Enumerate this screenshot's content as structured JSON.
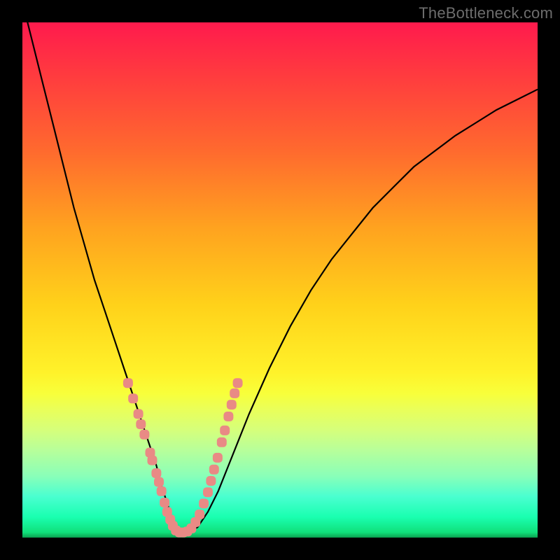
{
  "watermark": {
    "text": "TheBottleneck.com"
  },
  "chart_data": {
    "type": "line",
    "title": "",
    "xlabel": "",
    "ylabel": "",
    "xlim": [
      0,
      100
    ],
    "ylim": [
      0,
      100
    ],
    "series": [
      {
        "name": "bottleneck-curve",
        "x": [
          0,
          2,
          4,
          6,
          8,
          10,
          12,
          14,
          16,
          18,
          20,
          22,
          24,
          26,
          27,
          28,
          29,
          30,
          31,
          32,
          34,
          36,
          38,
          40,
          44,
          48,
          52,
          56,
          60,
          64,
          68,
          72,
          76,
          80,
          84,
          88,
          92,
          96,
          100
        ],
        "y": [
          104,
          96,
          88,
          80,
          72,
          64,
          57,
          50,
          44,
          38,
          32,
          26,
          20,
          14,
          10,
          7,
          4,
          2,
          1,
          1,
          2,
          5,
          9,
          14,
          24,
          33,
          41,
          48,
          54,
          59,
          64,
          68,
          72,
          75,
          78,
          80.5,
          83,
          85,
          87
        ]
      }
    ],
    "markers": [
      {
        "x": 20.5,
        "y": 30
      },
      {
        "x": 21.5,
        "y": 27
      },
      {
        "x": 22.5,
        "y": 24
      },
      {
        "x": 23.0,
        "y": 22
      },
      {
        "x": 23.7,
        "y": 20
      },
      {
        "x": 24.8,
        "y": 16.5
      },
      {
        "x": 25.2,
        "y": 15
      },
      {
        "x": 26.0,
        "y": 12.5
      },
      {
        "x": 26.5,
        "y": 10.8
      },
      {
        "x": 27.0,
        "y": 9.0
      },
      {
        "x": 27.6,
        "y": 6.8
      },
      {
        "x": 28.1,
        "y": 5.0
      },
      {
        "x": 28.7,
        "y": 3.5
      },
      {
        "x": 29.2,
        "y": 2.3
      },
      {
        "x": 29.8,
        "y": 1.4
      },
      {
        "x": 30.5,
        "y": 1.0
      },
      {
        "x": 31.2,
        "y": 1.0
      },
      {
        "x": 32.0,
        "y": 1.2
      },
      {
        "x": 32.8,
        "y": 1.8
      },
      {
        "x": 33.6,
        "y": 3.0
      },
      {
        "x": 34.4,
        "y": 4.5
      },
      {
        "x": 35.2,
        "y": 6.6
      },
      {
        "x": 36.0,
        "y": 8.8
      },
      {
        "x": 36.6,
        "y": 11.0
      },
      {
        "x": 37.2,
        "y": 13.2
      },
      {
        "x": 37.9,
        "y": 15.5
      },
      {
        "x": 38.7,
        "y": 18.5
      },
      {
        "x": 39.3,
        "y": 20.8
      },
      {
        "x": 40.0,
        "y": 23.5
      },
      {
        "x": 40.6,
        "y": 25.8
      },
      {
        "x": 41.2,
        "y": 28.0
      },
      {
        "x": 41.8,
        "y": 30.0
      }
    ],
    "marker_color": "#e98a85"
  }
}
